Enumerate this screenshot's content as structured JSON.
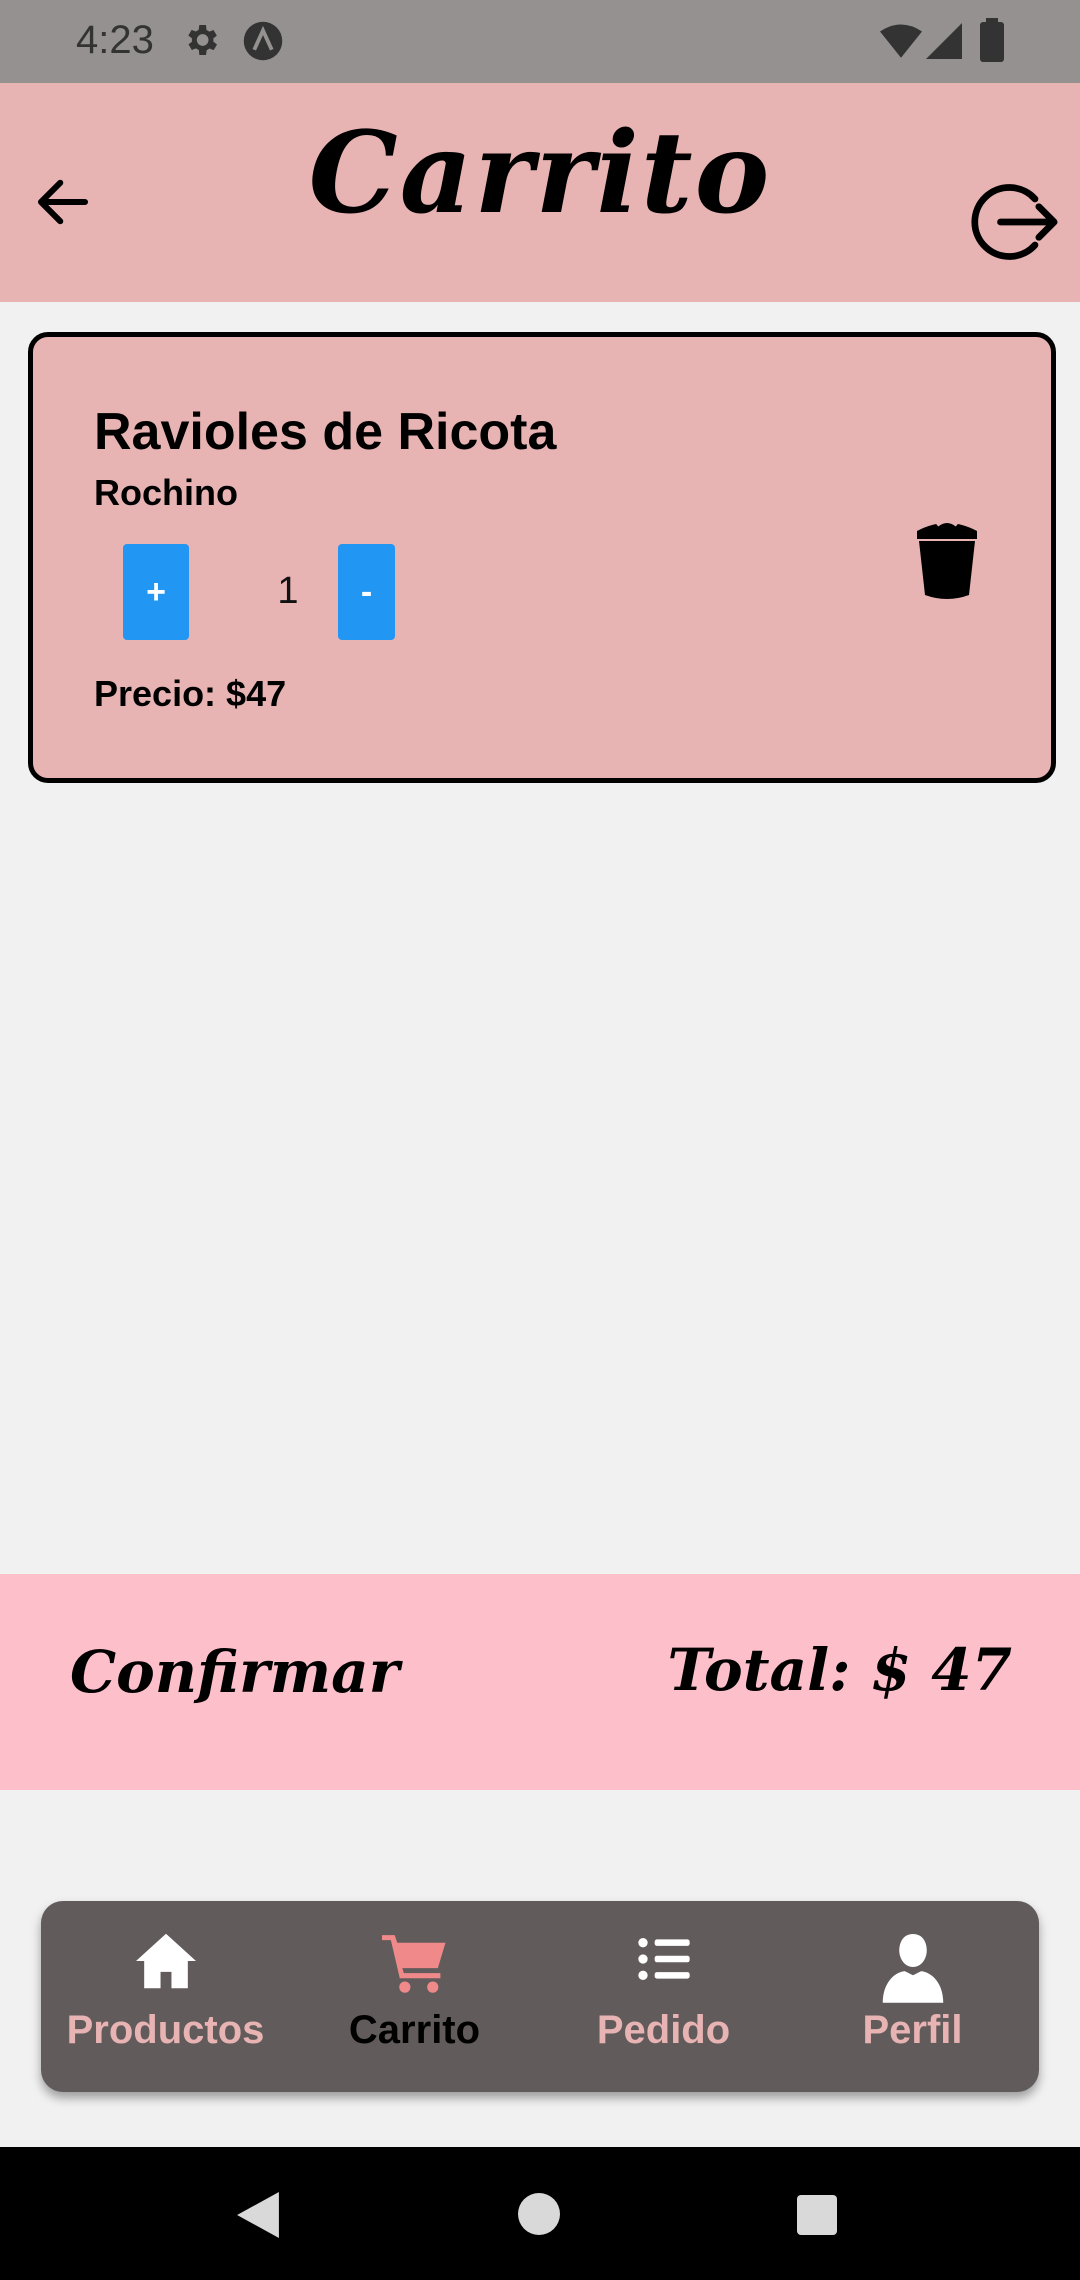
{
  "status_bar": {
    "time": "4:23",
    "icons": [
      "settings-icon",
      "app-notification-icon",
      "wifi-icon",
      "signal-icon",
      "battery-icon"
    ]
  },
  "app_bar": {
    "title": "Carrito",
    "back_icon": "arrow-left-icon",
    "logout_icon": "logout-icon"
  },
  "cart": {
    "items": [
      {
        "name": "Ravioles de Ricota",
        "brand": "Rochino",
        "increment_label": "+",
        "quantity": "1",
        "decrement_label": "-",
        "price": "Precio: $47",
        "delete_icon": "trash-icon"
      }
    ]
  },
  "footer": {
    "confirm_label": "Confirmar",
    "total": "Total: $ 47"
  },
  "bottom_nav": {
    "items": [
      {
        "label": "Productos",
        "icon": "home-icon",
        "active": false
      },
      {
        "label": "Carrito",
        "icon": "cart-icon",
        "active": true
      },
      {
        "label": "Pedido",
        "icon": "list-icon",
        "active": false
      },
      {
        "label": "Perfil",
        "icon": "user-icon",
        "active": false
      }
    ]
  },
  "colors": {
    "header": "#e8b3b3",
    "card": "#e8b3b3",
    "confirm_bar": "#fdbfca",
    "button_blue": "#2196f3",
    "nav_bg": "#625b5b",
    "nav_active_icon": "#f08a8a"
  }
}
